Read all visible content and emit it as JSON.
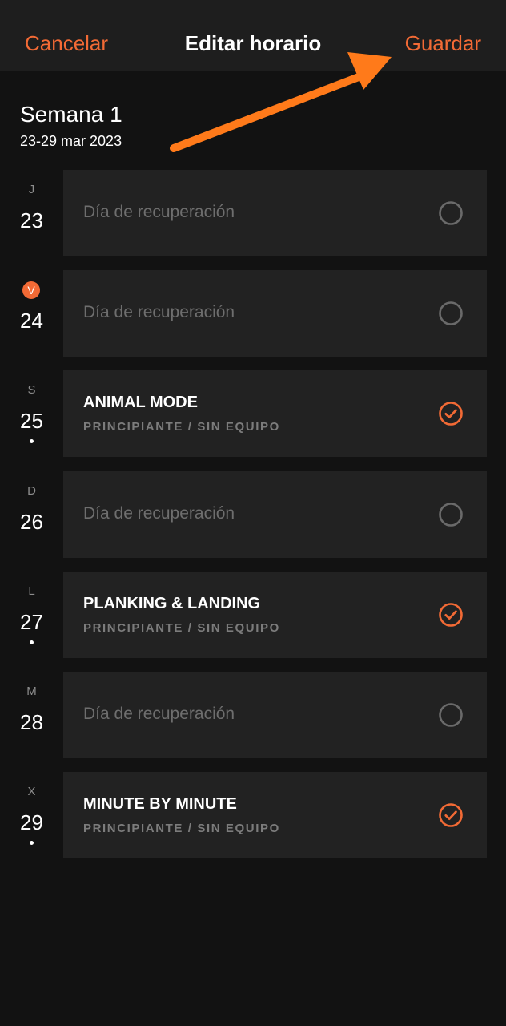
{
  "header": {
    "cancel_label": "Cancelar",
    "title": "Editar horario",
    "save_label": "Guardar"
  },
  "week": {
    "title": "Semana 1",
    "range": "23-29 mar 2023"
  },
  "colors": {
    "accent": "#f26a35",
    "annotation_arrow": "#ff7a1a",
    "background": "#121212",
    "card": "#222222"
  },
  "days": [
    {
      "letter": "J",
      "number": "23",
      "today": false,
      "has_dot": false,
      "type": "rest",
      "label": "Día de recuperación",
      "meta": "",
      "completed": false,
      "icon": "empty-circle-icon"
    },
    {
      "letter": "V",
      "number": "24",
      "today": true,
      "has_dot": false,
      "type": "rest",
      "label": "Día de recuperación",
      "meta": "",
      "completed": false,
      "icon": "empty-circle-icon"
    },
    {
      "letter": "S",
      "number": "25",
      "today": false,
      "has_dot": true,
      "type": "workout",
      "label": "ANIMAL MODE",
      "meta": "PRINCIPIANTE / SIN EQUIPO",
      "completed": true,
      "icon": "check-circle-icon"
    },
    {
      "letter": "D",
      "number": "26",
      "today": false,
      "has_dot": false,
      "type": "rest",
      "label": "Día de recuperación",
      "meta": "",
      "completed": false,
      "icon": "empty-circle-icon"
    },
    {
      "letter": "L",
      "number": "27",
      "today": false,
      "has_dot": true,
      "type": "workout",
      "label": "PLANKING & LANDING",
      "meta": "PRINCIPIANTE / SIN EQUIPO",
      "completed": true,
      "icon": "check-circle-icon"
    },
    {
      "letter": "M",
      "number": "28",
      "today": false,
      "has_dot": false,
      "type": "rest",
      "label": "Día de recuperación",
      "meta": "",
      "completed": false,
      "icon": "empty-circle-icon"
    },
    {
      "letter": "X",
      "number": "29",
      "today": false,
      "has_dot": true,
      "type": "workout",
      "label": "MINUTE BY MINUTE",
      "meta": "PRINCIPIANTE / SIN EQUIPO",
      "completed": true,
      "icon": "check-circle-icon"
    }
  ]
}
